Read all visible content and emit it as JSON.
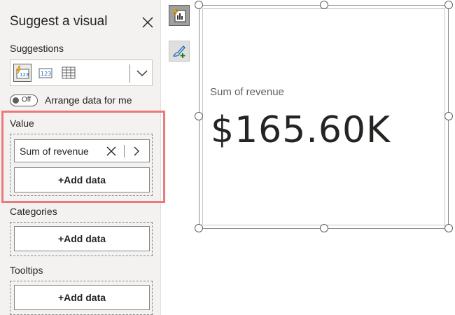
{
  "pane": {
    "title": "Suggest a visual",
    "suggestions_label": "Suggestions",
    "toggle": {
      "state": "Off",
      "label": "Arrange data for me"
    },
    "value_label": "Value",
    "value_field": "Sum of revenue",
    "categories_label": "Categories",
    "tooltips_label": "Tooltips",
    "add_data_label": "+Add data",
    "icons": [
      "quick-insight-card-icon",
      "card-icon",
      "table-icon",
      "chevron-down-icon"
    ]
  },
  "card": {
    "label": "Sum of revenue",
    "value": "$165.60K"
  },
  "colors": {
    "highlight": "#ea7a7a",
    "pane_bg": "#f3f2f1",
    "accent_lightning": "#f2a900",
    "accent_blue": "#0f6cbd"
  }
}
